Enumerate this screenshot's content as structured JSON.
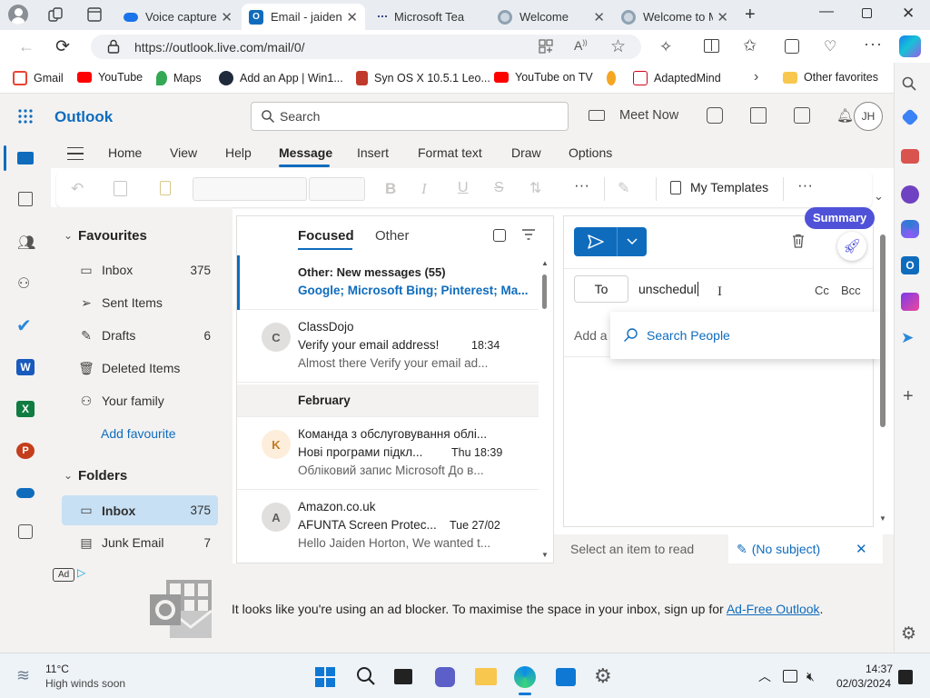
{
  "browser": {
    "tabs": [
      {
        "title": "Voice capture",
        "icon": "onedrive-icon"
      },
      {
        "title": "Email - jaiden",
        "icon": "outlook-icon"
      },
      {
        "title": "Microsoft Tea",
        "icon": "teams-icon"
      },
      {
        "title": "Welcome",
        "icon": "edge-icon"
      },
      {
        "title": "Welcome to M",
        "icon": "edge-icon"
      }
    ],
    "url": "https://outlook.live.com/mail/0/",
    "bookmarks": [
      {
        "label": "Gmail",
        "color": "#ea4335"
      },
      {
        "label": "YouTube",
        "color": "#ff0000"
      },
      {
        "label": "Maps",
        "color": "#34a853"
      },
      {
        "label": "Add an App | Win1...",
        "color": "#1f2b3a"
      },
      {
        "label": "Syn OS X 10.5.1 Leo...",
        "color": "#c0392b"
      },
      {
        "label": "YouTube on TV",
        "color": "#ff0000"
      },
      {
        "label": "",
        "color": "#f5a623"
      },
      {
        "label": "AdaptedMind",
        "color": "#d0021b"
      }
    ],
    "other_favorites": "Other favorites"
  },
  "outlook": {
    "brand": "Outlook",
    "search_placeholder": "Search",
    "meet_now": "Meet Now",
    "user_initials": "JH",
    "accent": "#0f6cbd"
  },
  "ribbon": {
    "tabs": [
      "Home",
      "View",
      "Help",
      "Message",
      "Insert",
      "Format text",
      "Draw",
      "Options"
    ],
    "active_tab": "Message",
    "my_templates": "My Templates"
  },
  "folders": {
    "favourites_title": "Favourites",
    "favourites": [
      {
        "label": "Inbox",
        "count": "375",
        "icon": "inbox-icon"
      },
      {
        "label": "Sent Items",
        "count": "",
        "icon": "send-icon"
      },
      {
        "label": "Drafts",
        "count": "6",
        "icon": "pencil-icon"
      },
      {
        "label": "Deleted Items",
        "count": "",
        "icon": "trash-icon"
      },
      {
        "label": "Your family",
        "count": "",
        "icon": "family-icon"
      }
    ],
    "add_favourite": "Add favourite",
    "folders_title": "Folders",
    "folders": [
      {
        "label": "Inbox",
        "count": "375",
        "icon": "inbox-icon"
      },
      {
        "label": "Junk Email",
        "count": "7",
        "icon": "junk-icon"
      }
    ]
  },
  "list": {
    "tab_focused": "Focused",
    "tab_other": "Other",
    "other_header": {
      "title": "Other: New messages (55)",
      "senders": "Google; Microsoft Bing; Pinterest; Ma..."
    },
    "month_divider": "February",
    "messages": [
      {
        "initial": "C",
        "sender": "ClassDojo",
        "subject": "Verify your email address!",
        "time": "18:34",
        "preview": "Almost there Verify your email ad...",
        "avatar_bg": "#e1dfdd",
        "avatar_fg": "#605e5c"
      },
      {
        "initial": "K",
        "sender": "Команда з обслуговування облі...",
        "subject": "Нові програми підкл...",
        "time": "Thu 18:39",
        "preview": "Обліковий запис Microsoft До в...",
        "avatar_bg": "#fdeedb",
        "avatar_fg": "#c47a1e"
      },
      {
        "initial": "A",
        "sender": "Amazon.co.uk",
        "subject": "AFUNTA Screen Protec...",
        "time": "Tue 27/02",
        "preview": "Hello Jaiden Horton, We wanted t...",
        "avatar_bg": "#e1dfdd",
        "avatar_fg": "#605e5c"
      }
    ]
  },
  "compose": {
    "summary": "Summary",
    "to_label": "To",
    "to_value": "unschedul",
    "cc": "Cc",
    "bcc": "Bcc",
    "add_subject": "Add a",
    "search_people": "Search People"
  },
  "bottom": {
    "select_item": "Select an item to read",
    "no_subject": "(No subject)"
  },
  "ad": {
    "badge": "Ad",
    "message": "It looks like you're using an ad blocker. To maximise the space in your inbox, sign up for ",
    "link": "Ad-Free Outlook",
    "tail": "."
  },
  "taskbar": {
    "weather_temp": "11°C",
    "weather_desc": "High winds soon",
    "time": "14:37",
    "date": "02/03/2024"
  }
}
